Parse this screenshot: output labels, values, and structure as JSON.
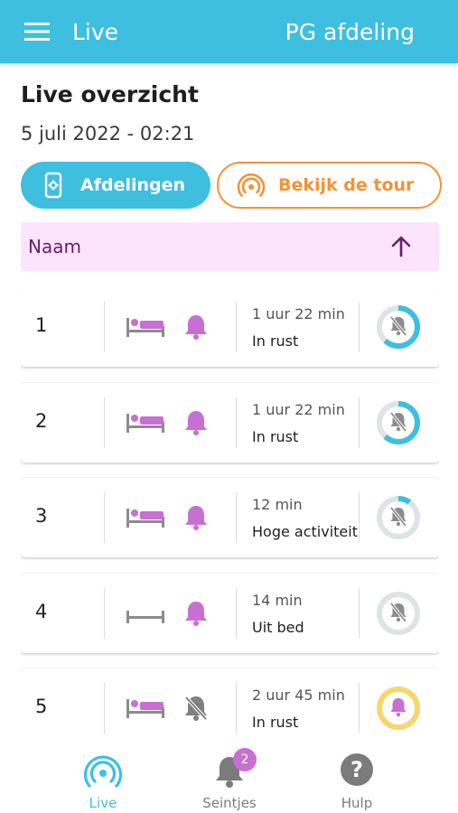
{
  "appbar": {
    "title": "Live",
    "department": "PG afdeling",
    "menu_icon": "hamburger-menu-icon",
    "color": "#3ebfdf"
  },
  "header": {
    "title": "Live overzicht",
    "date": "5 juli 2022 - 02:21"
  },
  "actions": {
    "afdelingen_label": "Afdelingen",
    "afdelingen_icon": "phone-settings-icon",
    "tour_label": "Bekijk de tour",
    "tour_icon": "broadcast-icon",
    "tour_color": "#f39236"
  },
  "sort": {
    "label": "Naam",
    "direction_icon": "arrow-up-icon"
  },
  "rooms": [
    {
      "number": "1",
      "bed": "occupied",
      "bell": "active",
      "duration": "1 uur 22 min",
      "status": "In rust",
      "ring_color": "#3ebfdf",
      "ring_fraction": 0.62,
      "ring_icon": "bell-off"
    },
    {
      "number": "2",
      "bed": "occupied",
      "bell": "active",
      "duration": "1 uur 22 min",
      "status": "In rust",
      "ring_color": "#3ebfdf",
      "ring_fraction": 0.62,
      "ring_icon": "bell-off"
    },
    {
      "number": "3",
      "bed": "occupied",
      "bell": "active",
      "duration": "12 min",
      "status": "Hoge activiteit",
      "ring_color": "#3ebfdf",
      "ring_fraction": 0.1,
      "ring_icon": "bell-off"
    },
    {
      "number": "4",
      "bed": "empty",
      "bell": "active",
      "duration": "14 min",
      "status": "Uit bed",
      "ring_color": "#3ebfdf",
      "ring_fraction": 0.0,
      "ring_icon": "bell-off"
    },
    {
      "number": "5",
      "bed": "occupied",
      "bell": "muted",
      "duration": "2 uur 45 min",
      "status": "In rust",
      "ring_color": "#f5d76e",
      "ring_fraction": 1.0,
      "ring_icon": "bell"
    }
  ],
  "nav": {
    "live_label": "Live",
    "seintjes_label": "Seintjes",
    "seintjes_badge": "2",
    "hulp_label": "Hulp"
  }
}
